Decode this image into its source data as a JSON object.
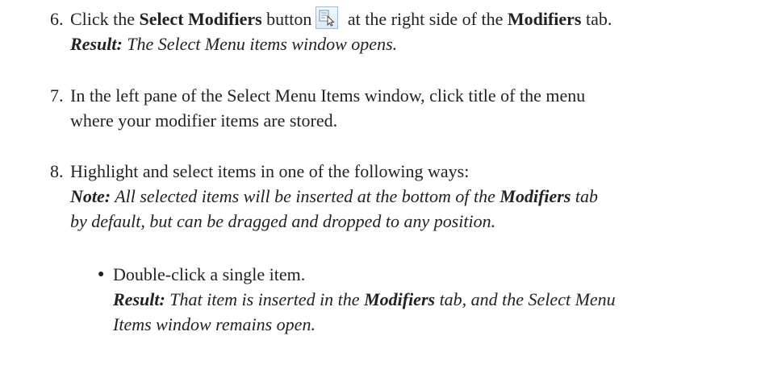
{
  "steps": [
    {
      "number": "6.",
      "text_a": "Click the ",
      "bold_a": "Select Modifiers",
      "text_b": " button",
      "icon": "select-modifiers-icon",
      "text_c": " at the right side of the ",
      "bold_b": "Modifiers",
      "text_d": " tab.",
      "result_label": "Result:",
      "result_text": " The Select Menu items window opens."
    },
    {
      "number": "7.",
      "line1": "In the left pane of the Select Menu Items window, click title of the menu",
      "line2": "where your modifier items are stored."
    },
    {
      "number": "8.",
      "line1": "Highlight and select items in one of the following ways:",
      "note_label": "Note:",
      "note_a": " All selected items will be inserted at the bottom of the ",
      "note_bold": "Modifiers",
      "note_b": " tab",
      "note_line2": "by default, but can be dragged and dropped to any position."
    }
  ],
  "bullets": [
    {
      "text": "Double-click a single item.",
      "result_label": "Result:",
      "result_a": " That item is inserted in the ",
      "result_bold": "Modifiers",
      "result_b": " tab, and the Select Menu",
      "result_line2": "Items window remains open."
    }
  ]
}
